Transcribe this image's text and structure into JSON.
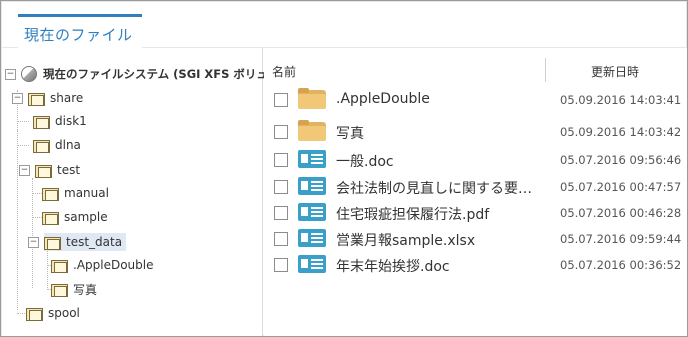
{
  "tab": {
    "label": "現在のファイル"
  },
  "tree": {
    "root": "現在のファイルシステム (SGI XFS ボリューム",
    "share": "share",
    "disk1": "disk1",
    "dlna": "dlna",
    "test": "test",
    "manual": "manual",
    "sample": "sample",
    "test_data": "test_data",
    "appledouble": ".AppleDouble",
    "photo": "写真",
    "spool": "spool"
  },
  "list": {
    "col_name": "名前",
    "col_date": "更新日時",
    "files": [
      {
        "name": ".AppleDouble",
        "date": "05.09.2016 14:03:41",
        "icon": "folder-icon"
      },
      {
        "name": "写真",
        "date": "05.09.2016 14:03:42",
        "icon": "folder-icon"
      },
      {
        "name": "一般.doc",
        "date": "05.07.2016 09:56:46",
        "icon": "document-icon"
      },
      {
        "name": "会社法制の見直しに関する要…",
        "date": "05.07.2016 00:47:57",
        "icon": "document-icon"
      },
      {
        "name": "住宅瑕疵担保履行法.pdf",
        "date": "05.07.2016 00:46:28",
        "icon": "document-icon"
      },
      {
        "name": "営業月報sample.xlsx",
        "date": "05.07.2016 09:59:44",
        "icon": "document-icon"
      },
      {
        "name": "年末年始挨拶.doc",
        "date": "05.07.2016 00:36:52",
        "icon": "document-icon"
      }
    ]
  }
}
